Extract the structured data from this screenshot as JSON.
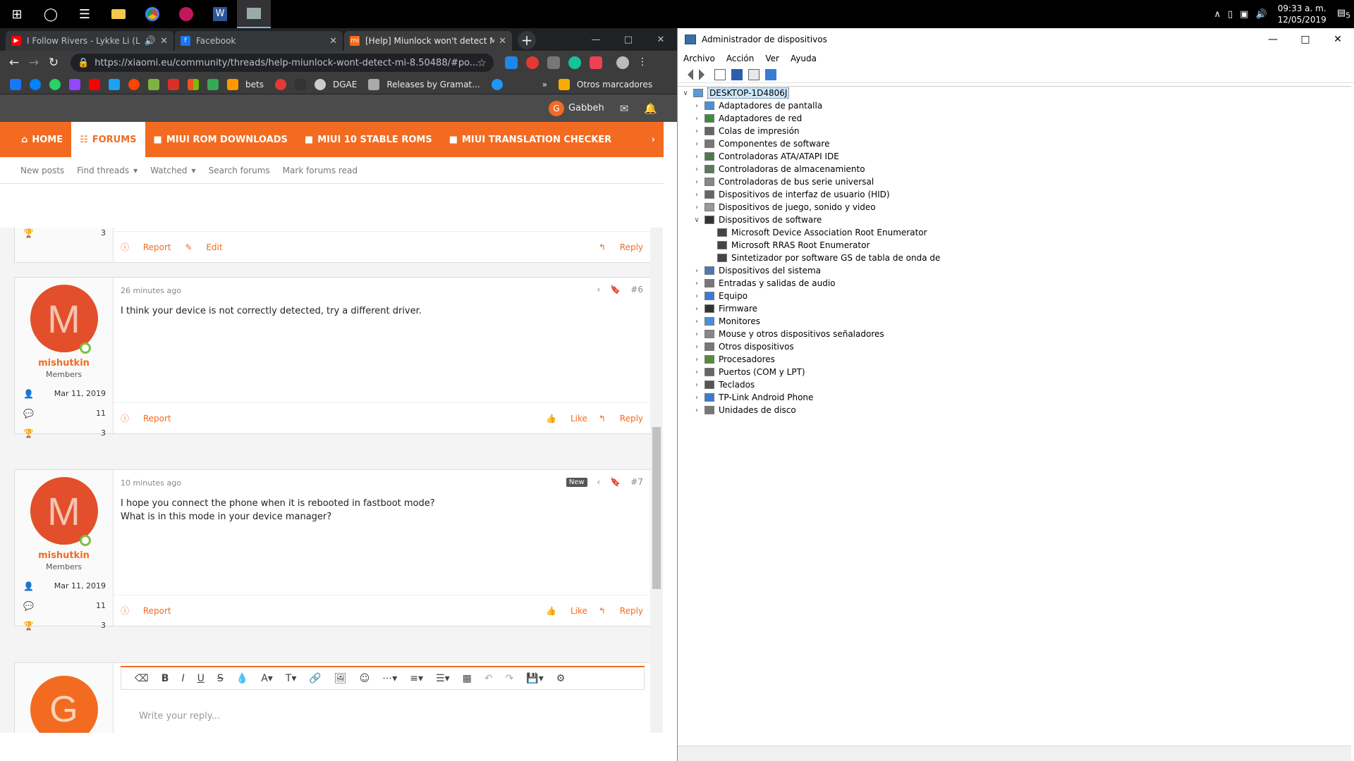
{
  "taskbar": {
    "apps": [
      "windows-start",
      "cortana",
      "task-view",
      "file-explorer",
      "chrome",
      "media-app",
      "word",
      "remote-desktop"
    ],
    "time": "09:33 a. m.",
    "date": "12/05/2019",
    "notifications": "5"
  },
  "browser": {
    "tabs": [
      {
        "title": "I Follow Rivers - Lykke Li (La",
        "color": "#ff0000",
        "icon": "youtube-icon"
      },
      {
        "title": "Facebook",
        "color": "#1877f2",
        "icon": "facebook-icon"
      },
      {
        "title": "[Help] Miunlock won't detect Mi",
        "color": "#f36b21",
        "icon": "xiaomi-icon"
      }
    ],
    "url": "https://xiaomi.eu/community/threads/help-miunlock-wont-detect-mi-8.50488/#po...",
    "bookmarks": {
      "bets": "bets",
      "dgae": "DGAE",
      "releases": "Releases by Gramat...",
      "more": "»",
      "others": "Otros marcadores"
    }
  },
  "site": {
    "user": "Gabbeh",
    "user_initial": "G",
    "nav": [
      {
        "label": "HOME",
        "icon": "home-icon"
      },
      {
        "label": "FORUMS",
        "icon": "forums-icon"
      },
      {
        "label": "MIUI ROM DOWNLOADS",
        "icon": "folder-icon"
      },
      {
        "label": "MIUI 10 STABLE ROMS",
        "icon": "folder-icon"
      },
      {
        "label": "MIUI TRANSLATION CHECKER",
        "icon": "folder-icon"
      }
    ],
    "subnav": [
      "New posts",
      "Find threads",
      "Watched",
      "Search forums",
      "Mark forums read"
    ],
    "first_post_footer": {
      "count": "3",
      "report": "Report",
      "edit": "Edit",
      "reply": "Reply"
    },
    "posts": [
      {
        "time": "26 minutes ago",
        "number": "#6",
        "new": "",
        "author": "mishutkin",
        "initial": "M",
        "role": "Members",
        "joined": "Mar 11, 2019",
        "messages": "11",
        "points": "3",
        "text1": "I think your device is not correctly detected, try a different driver.",
        "text2": "",
        "report": "Report",
        "like": "Like",
        "reply": "Reply"
      },
      {
        "time": "10 minutes ago",
        "number": "#7",
        "new": "New",
        "author": "mishutkin",
        "initial": "M",
        "role": "Members",
        "joined": "Mar 11, 2019",
        "messages": "11",
        "points": "3",
        "text1": "I hope you connect the phone when it is rebooted in fastboot mode?",
        "text2": "What is in this mode in your device manager?",
        "report": "Report",
        "like": "Like",
        "reply": "Reply"
      }
    ],
    "reply_placeholder": "Write your reply...",
    "accent": "#f36b21"
  },
  "devmgr": {
    "title": "Administrador de dispositivos",
    "menu": [
      "Archivo",
      "Acción",
      "Ver",
      "Ayuda"
    ],
    "root": "DESKTOP-1D4806J",
    "nodes": [
      {
        "label": "Adaptadores de pantalla",
        "expanded": false,
        "level": 1
      },
      {
        "label": "Adaptadores de red",
        "expanded": false,
        "level": 1
      },
      {
        "label": "Colas de impresión",
        "expanded": false,
        "level": 1
      },
      {
        "label": "Componentes de software",
        "expanded": false,
        "level": 1
      },
      {
        "label": "Controladoras ATA/ATAPI IDE",
        "expanded": false,
        "level": 1
      },
      {
        "label": "Controladoras de almacenamiento",
        "expanded": false,
        "level": 1
      },
      {
        "label": "Controladoras de bus serie universal",
        "expanded": false,
        "level": 1
      },
      {
        "label": "Dispositivos de interfaz de usuario (HID)",
        "expanded": false,
        "level": 1
      },
      {
        "label": "Dispositivos de juego, sonido y video",
        "expanded": false,
        "level": 1
      },
      {
        "label": "Dispositivos de software",
        "expanded": true,
        "level": 1
      },
      {
        "label": "Microsoft Device Association Root Enumerator",
        "expanded": null,
        "level": 2
      },
      {
        "label": "Microsoft RRAS Root Enumerator",
        "expanded": null,
        "level": 2
      },
      {
        "label": "Sintetizador por software GS de tabla de onda de",
        "expanded": null,
        "level": 2
      },
      {
        "label": "Dispositivos del sistema",
        "expanded": false,
        "level": 1
      },
      {
        "label": "Entradas y salidas de audio",
        "expanded": false,
        "level": 1
      },
      {
        "label": "Equipo",
        "expanded": false,
        "level": 1
      },
      {
        "label": "Firmware",
        "expanded": false,
        "level": 1
      },
      {
        "label": "Monitores",
        "expanded": false,
        "level": 1
      },
      {
        "label": "Mouse y otros dispositivos señaladores",
        "expanded": false,
        "level": 1
      },
      {
        "label": "Otros dispositivos",
        "expanded": false,
        "level": 1
      },
      {
        "label": "Procesadores",
        "expanded": false,
        "level": 1
      },
      {
        "label": "Puertos (COM y LPT)",
        "expanded": false,
        "level": 1
      },
      {
        "label": "Teclados",
        "expanded": false,
        "level": 1
      },
      {
        "label": "TP-Link Android Phone",
        "expanded": false,
        "level": 1
      },
      {
        "label": "Unidades de disco",
        "expanded": false,
        "level": 1
      }
    ]
  }
}
